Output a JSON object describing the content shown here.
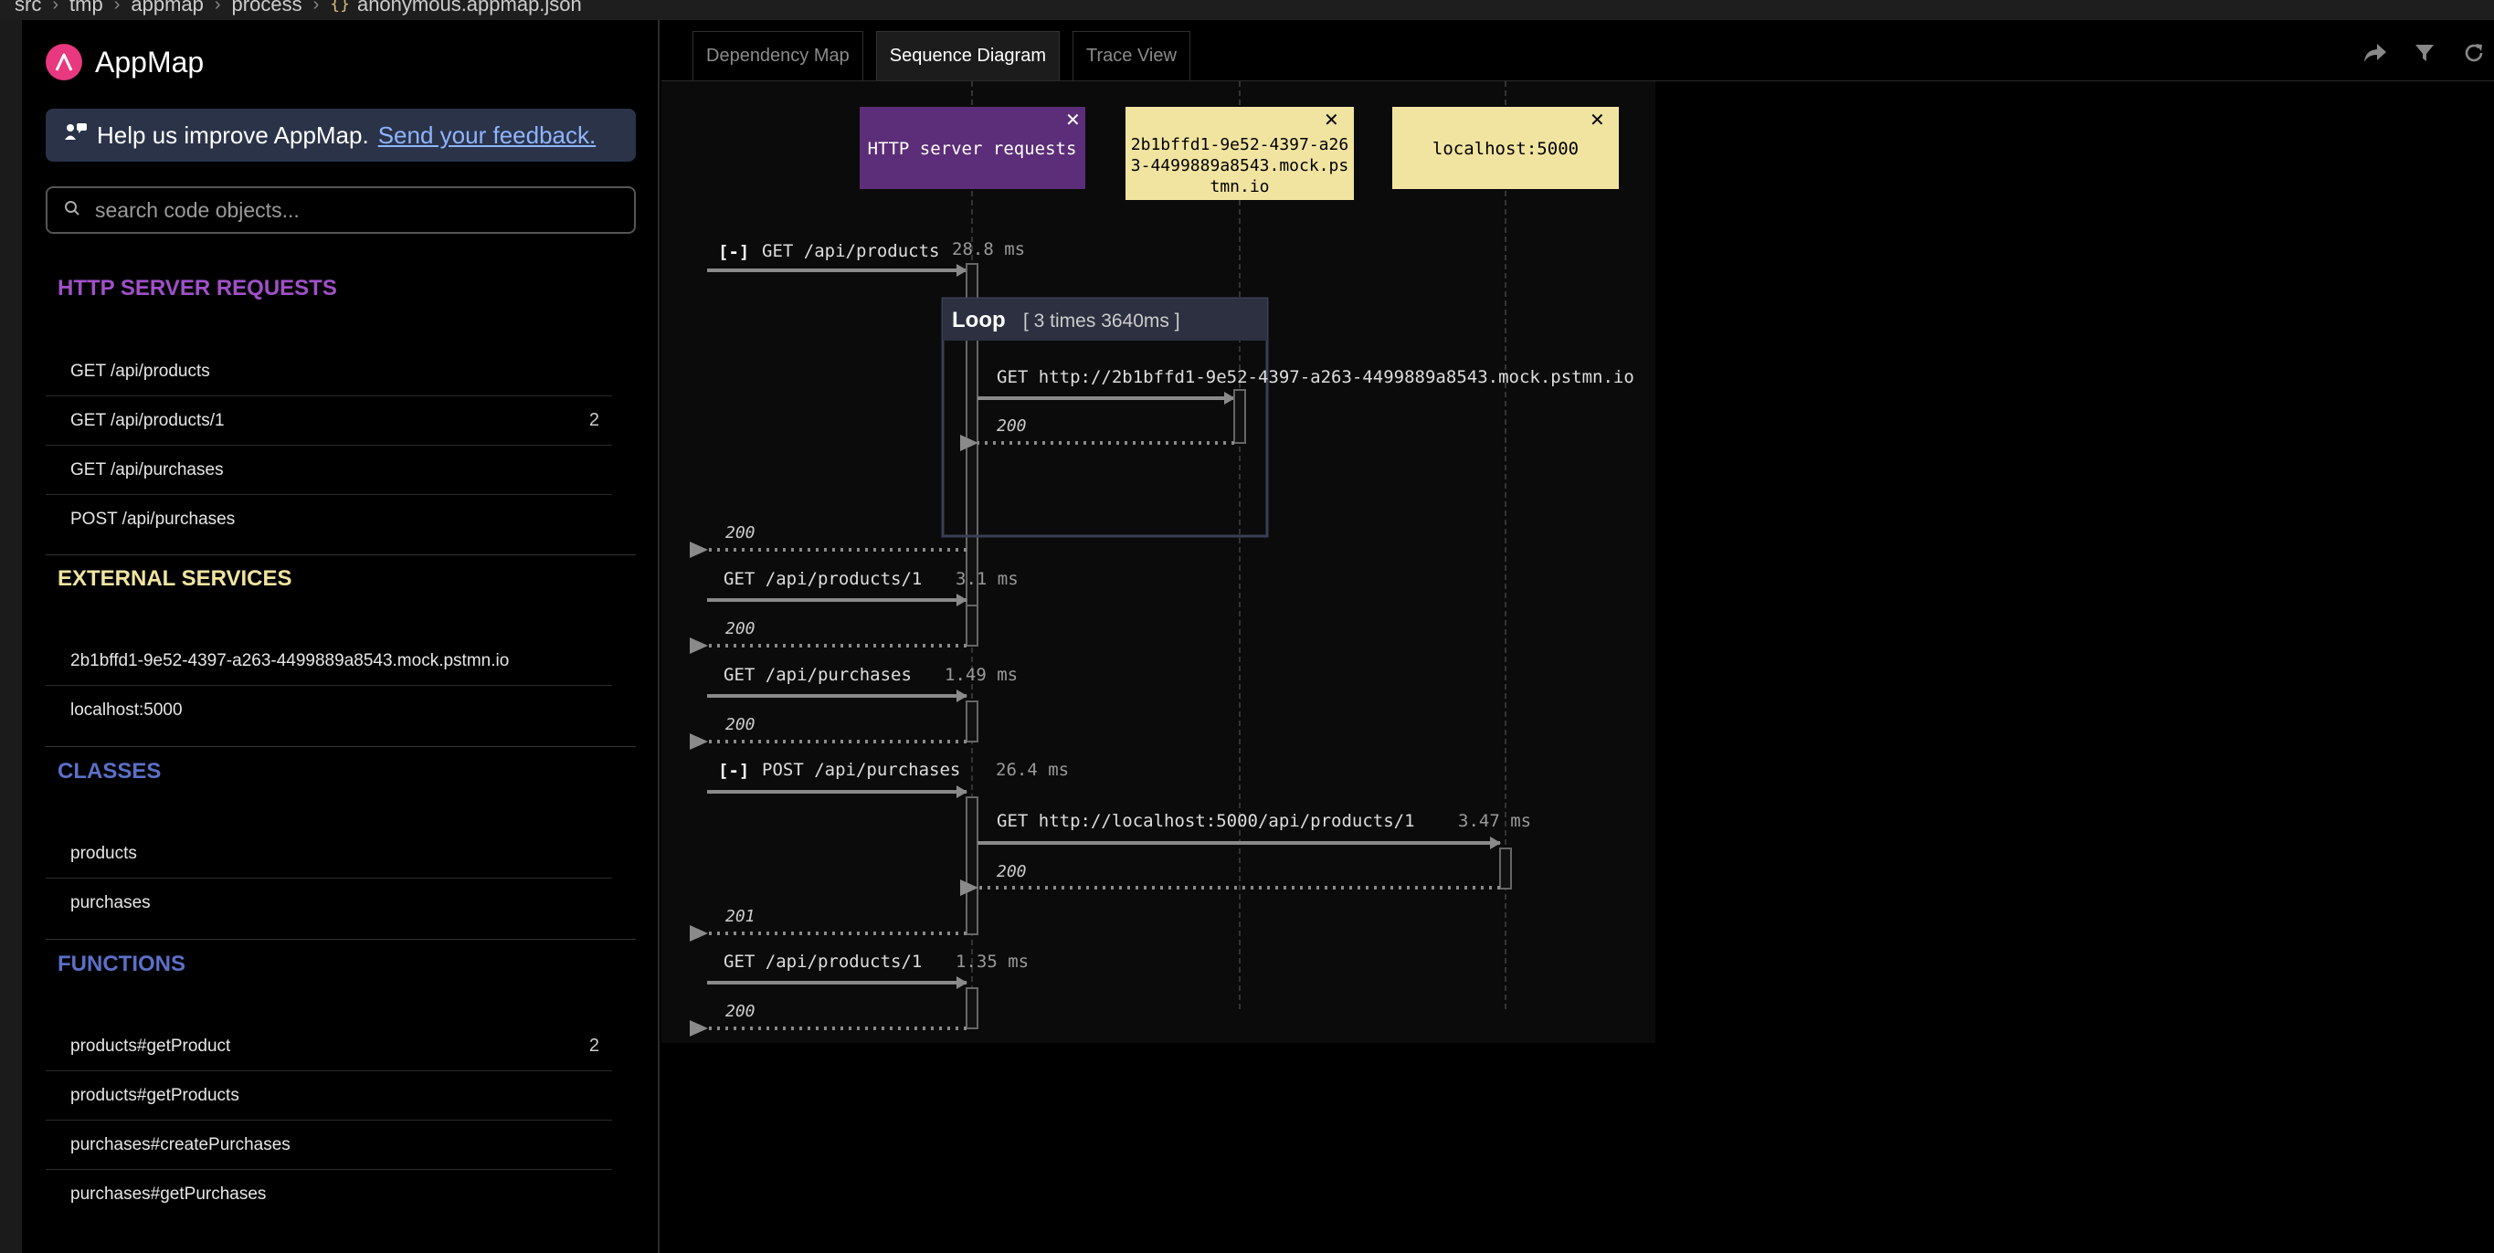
{
  "breadcrumb": {
    "parts": [
      "src",
      "tmp",
      "appmap",
      "process"
    ],
    "file": "anonymous.appmap.json"
  },
  "brand": {
    "name": "AppMap",
    "color": "#e8387f"
  },
  "feedback": {
    "text": "Help us improve AppMap.",
    "link": "Send your feedback."
  },
  "search": {
    "placeholder": "search code objects..."
  },
  "sections": {
    "http": {
      "title": "HTTP SERVER REQUESTS",
      "color": "#a050c8",
      "items": [
        {
          "label": "GET /api/products",
          "count": ""
        },
        {
          "label": "GET /api/products/1",
          "count": "2"
        },
        {
          "label": "GET /api/purchases",
          "count": ""
        },
        {
          "label": "POST /api/purchases",
          "count": ""
        }
      ]
    },
    "external": {
      "title": "EXTERNAL SERVICES",
      "color": "#f0e4a0",
      "items": [
        {
          "label": "2b1bffd1-9e52-4397-a263-4499889a8543.mock.pstmn.io",
          "count": ""
        },
        {
          "label": "localhost:5000",
          "count": ""
        }
      ]
    },
    "classes": {
      "title": "CLASSES",
      "color": "#5b70c8",
      "items": [
        {
          "label": "products",
          "count": ""
        },
        {
          "label": "purchases",
          "count": ""
        }
      ]
    },
    "functions": {
      "title": "FUNCTIONS",
      "color": "#5b70c8",
      "items": [
        {
          "label": "products#getProduct",
          "count": "2"
        },
        {
          "label": "products#getProducts",
          "count": ""
        },
        {
          "label": "purchases#createPurchases",
          "count": ""
        },
        {
          "label": "purchases#getPurchases",
          "count": ""
        }
      ]
    }
  },
  "tabs": [
    {
      "label": "Dependency Map",
      "active": false
    },
    {
      "label": "Sequence Diagram",
      "active": true
    },
    {
      "label": "Trace View",
      "active": false
    }
  ],
  "toolbar": {
    "icons": [
      "share-icon",
      "filter-icon",
      "refresh-icon"
    ]
  },
  "diagram": {
    "actors": [
      {
        "label": "HTTP server requests",
        "kind": "http",
        "bg": "#5c2d78",
        "fg": "#ffffff"
      },
      {
        "label": "2b1bffd1-9e52-4397-a26",
        "label2": "3-4499889a8543.mock.ps",
        "label3": "tmn.io",
        "kind": "external",
        "bg": "#f0e4a0",
        "fg": "#000000"
      },
      {
        "label": "localhost:5000",
        "kind": "external",
        "bg": "#f0e4a0",
        "fg": "#000000"
      }
    ],
    "collapse_marker": "[-]",
    "loop": {
      "title": "Loop",
      "detail": "[ 3 times 3640ms ]"
    },
    "calls": [
      {
        "label": "GET /api/products",
        "time": "28.8 ms",
        "return": "200",
        "collapsible": true
      },
      {
        "label": "GET http://2b1bffd1-9e52-4397-a263-4499889a8543.mock.pstmn.io",
        "time": "",
        "return": "200",
        "collapsible": false
      },
      {
        "label": "GET /api/products/1",
        "time": "3.1 ms",
        "return": "200",
        "collapsible": false
      },
      {
        "label": "GET /api/purchases",
        "time": "1.49 ms",
        "return": "200",
        "collapsible": false
      },
      {
        "label": "POST /api/purchases",
        "time": "26.4 ms",
        "return": "201",
        "collapsible": true
      },
      {
        "label": "GET http://localhost:5000/api/products/1",
        "time": "3.47 ms",
        "return": "200",
        "collapsible": false
      },
      {
        "label": "GET /api/products/1",
        "time": "1.35 ms",
        "return": "200",
        "collapsible": false
      }
    ]
  }
}
